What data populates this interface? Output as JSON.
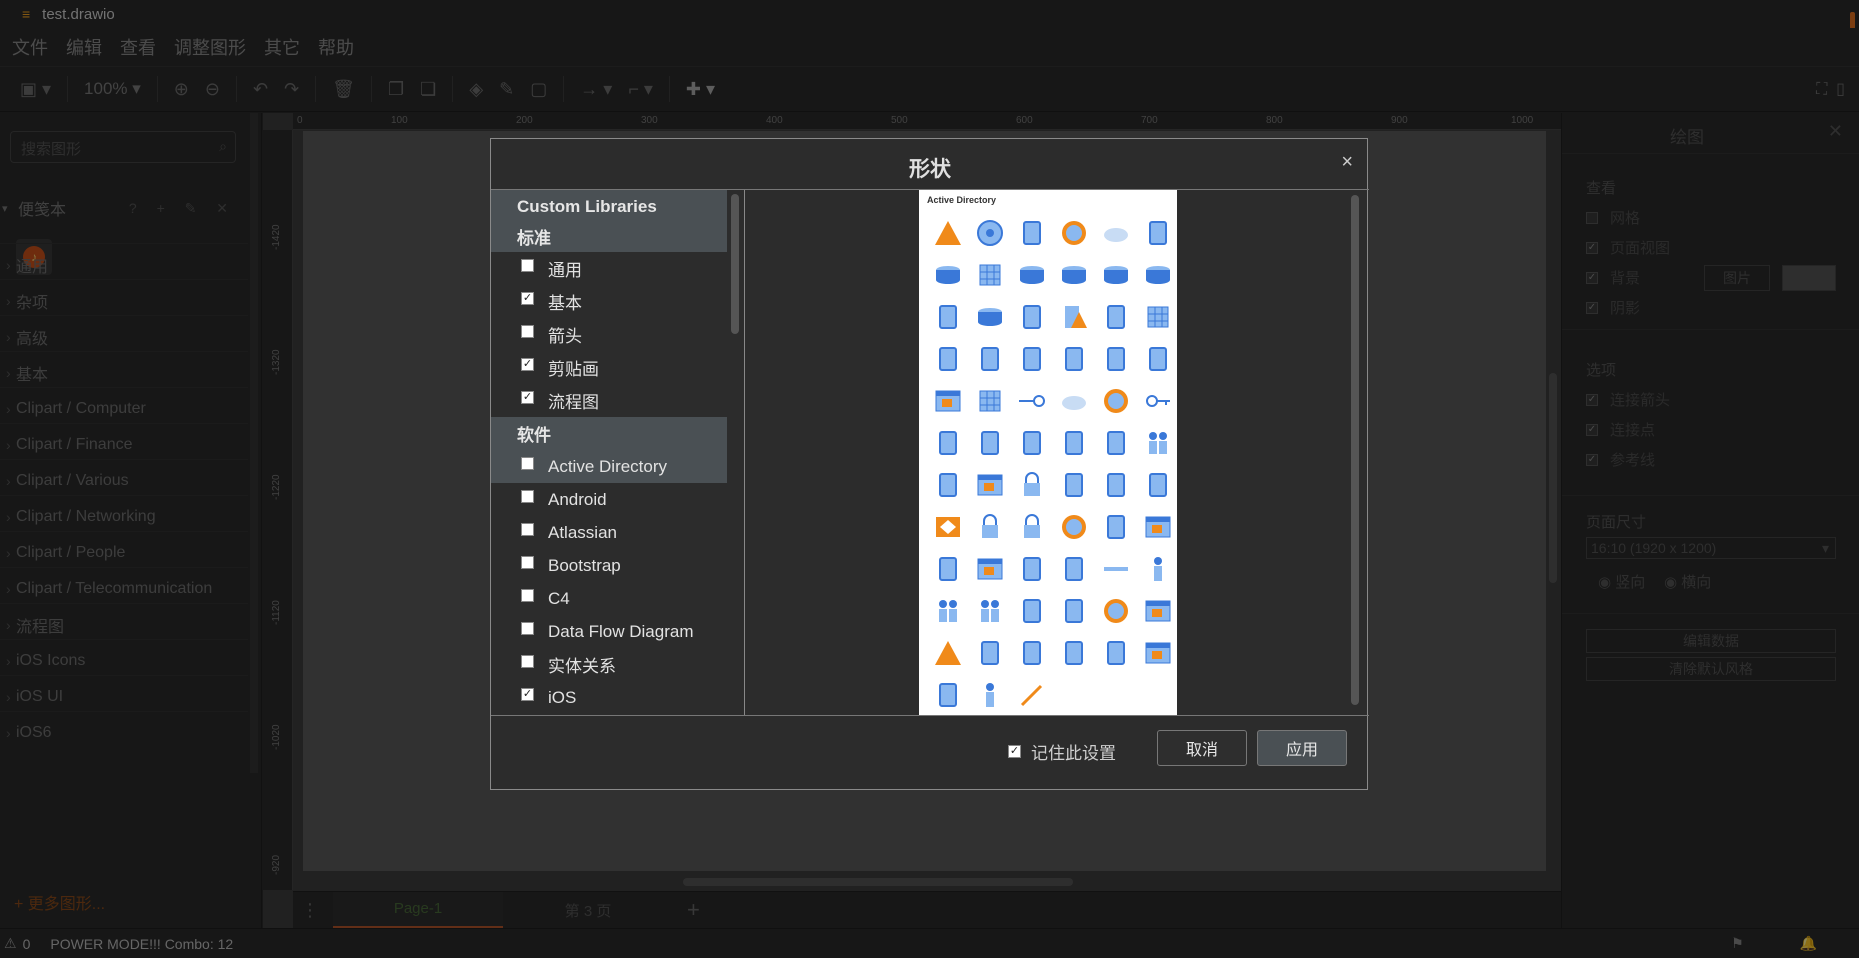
{
  "window": {
    "title": "test.drawio"
  },
  "menubar": [
    "文件",
    "编辑",
    "查看",
    "调整图形",
    "其它",
    "帮助"
  ],
  "toolbar": {
    "zoom": "100%"
  },
  "sidebar": {
    "search_placeholder": "搜索图形",
    "scratchpad": "便笺本",
    "scratchpad_controls": "? + ✎ ✕",
    "categories": [
      "通用",
      "杂项",
      "高级",
      "基本",
      "Clipart / Computer",
      "Clipart / Finance",
      "Clipart / Various",
      "Clipart / Networking",
      "Clipart / People",
      "Clipart / Telecommunication",
      "流程图",
      "iOS Icons",
      "iOS UI",
      "iOS6"
    ],
    "more_shapes": "+ 更多图形..."
  },
  "ruler": {
    "top": [
      "0",
      "100",
      "200",
      "300",
      "400",
      "500",
      "600",
      "700",
      "800",
      "900",
      "1000"
    ],
    "left": [
      "-1420",
      "-1320",
      "-1220",
      "-1120",
      "-1020",
      "-920"
    ]
  },
  "pages": {
    "tabs": [
      "Page-1",
      "第 3 页"
    ]
  },
  "format_panel": {
    "title": "绘图",
    "view_label": "查看",
    "view_checks": [
      {
        "label": "网格",
        "checked": false
      },
      {
        "label": "页面视图",
        "checked": true
      },
      {
        "label": "背景",
        "checked": true
      },
      {
        "label": "阴影",
        "checked": true
      }
    ],
    "image_button": "图片",
    "options_label": "选项",
    "option_checks": [
      {
        "label": "连接箭头",
        "checked": true
      },
      {
        "label": "连接点",
        "checked": true
      },
      {
        "label": "参考线",
        "checked": true
      }
    ],
    "page_size_label": "页面尺寸",
    "page_size_value": "16:10 (1920 x 1200)",
    "orientation": [
      "竖向",
      "横向"
    ],
    "edit_data": "编辑数据",
    "clear_style": "清除默认风格"
  },
  "status": {
    "count": "0",
    "text": "POWER MODE!!! Combo: 12"
  },
  "dialog": {
    "title": "形状",
    "close": "×",
    "groups": {
      "custom": "Custom Libraries",
      "standard": "标准",
      "software": "软件"
    },
    "standard_items": [
      {
        "label": "通用",
        "checked": false
      },
      {
        "label": "基本",
        "checked": true
      },
      {
        "label": "箭头",
        "checked": false
      },
      {
        "label": "剪贴画",
        "checked": true
      },
      {
        "label": "流程图",
        "checked": true
      }
    ],
    "software_items": [
      {
        "label": "Active Directory",
        "checked": false
      },
      {
        "label": "Android",
        "checked": false
      },
      {
        "label": "Atlassian",
        "checked": false
      },
      {
        "label": "Bootstrap",
        "checked": false
      },
      {
        "label": "C4",
        "checked": false
      },
      {
        "label": "Data Flow Diagram",
        "checked": false
      },
      {
        "label": "实体关系",
        "checked": false
      },
      {
        "label": "iOS",
        "checked": true
      }
    ],
    "preview_title": "Active Directory",
    "remember_label": "记住此设置",
    "remember_checked": true,
    "cancel": "取消",
    "apply": "应用"
  }
}
